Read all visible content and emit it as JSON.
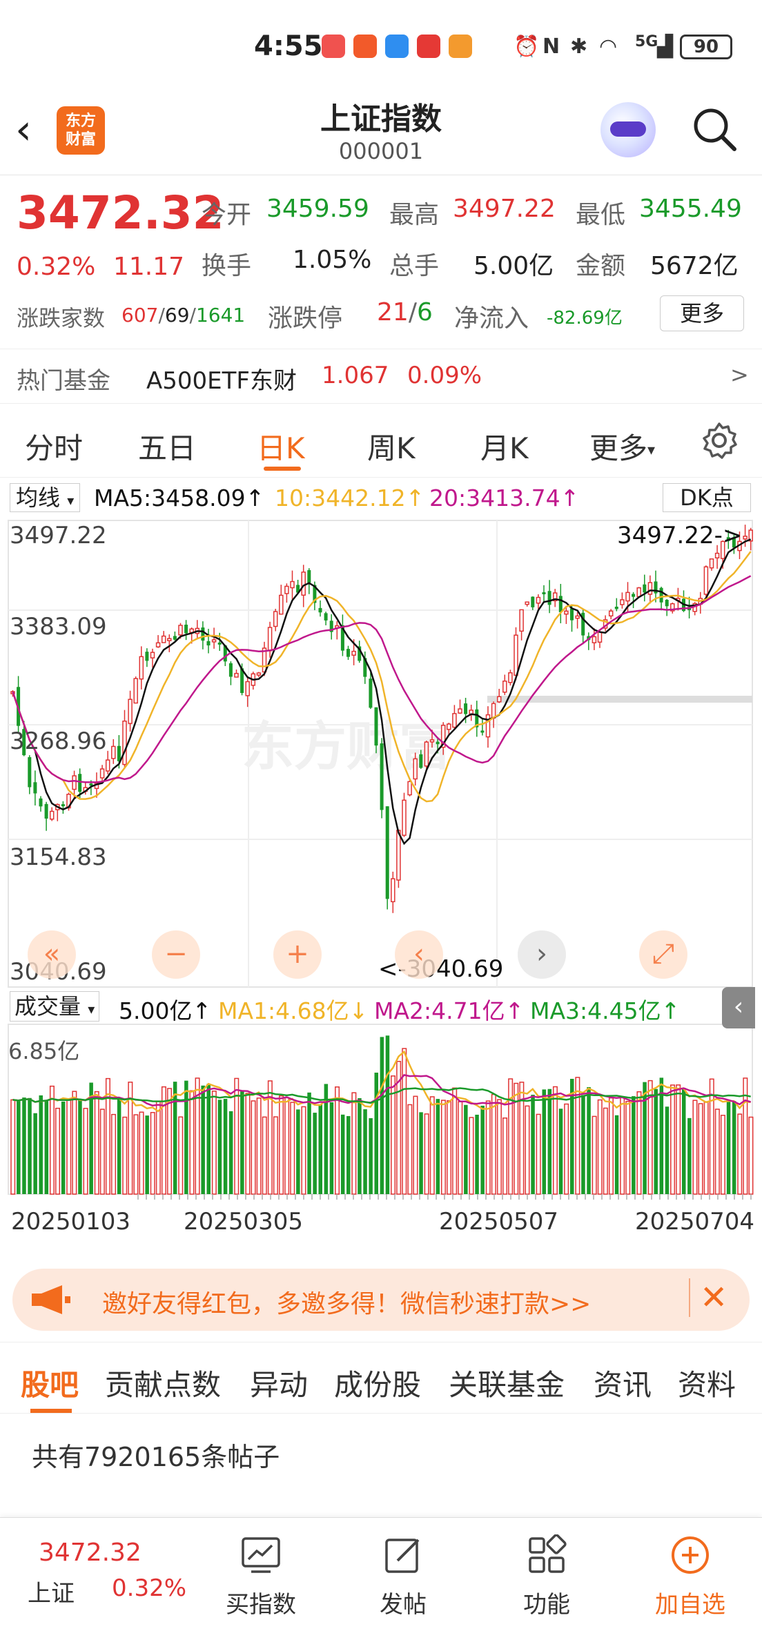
{
  "status": {
    "time": "4:55",
    "battery": "90",
    "network": "5G"
  },
  "header": {
    "title": "上证指数",
    "code": "000001",
    "logo_line1": "东方",
    "logo_line2": "财富"
  },
  "quote": {
    "price": "3472.32",
    "change_pct": "0.32%",
    "change_abs": "11.17",
    "open_label": "今开",
    "open": "3459.59",
    "high_label": "最高",
    "high": "3497.22",
    "low_label": "最低",
    "low": "3455.49",
    "turnover_label": "换手",
    "turnover": "1.05%",
    "volume_label": "总手",
    "volume": "5.00亿",
    "amount_label": "金额",
    "amount": "5672亿",
    "updown_label": "涨跌家数",
    "up_count": "607",
    "flat_count": "69",
    "down_count": "1641",
    "limit_label": "涨跌停",
    "limit_up": "21",
    "limit_down": "6",
    "netflow_label": "净流入",
    "netflow": "-82.69亿",
    "more_label": "更多"
  },
  "hotfund": {
    "label": "热门基金",
    "name": "A500ETF东财",
    "price": "1.067",
    "pct": "0.09%",
    "arrow": ">"
  },
  "period_tabs": [
    "分时",
    "五日",
    "日K",
    "周K",
    "月K",
    "更多"
  ],
  "active_period": "日K",
  "ma_bar": {
    "select": "均线",
    "ma5": "MA5:3458.09↑",
    "ma10": "10:3442.12↑",
    "ma20": "20:3413.74↑",
    "dk": "DK点",
    "colors": {
      "ma5": "#111111",
      "ma10": "#f0b429",
      "ma20": "#c0188c"
    }
  },
  "chart": {
    "y_labels": [
      "3497.22",
      "3383.09",
      "3268.96",
      "3154.83",
      "3040.69"
    ],
    "max_marker": "3497.22->",
    "min_marker": "<-3040.69",
    "watermark": "东方财富"
  },
  "vol_bar": {
    "select": "成交量",
    "vol": "5.00亿↑",
    "ma1": "MA1:4.68亿↓",
    "ma2": "MA2:4.71亿↑",
    "ma3": "MA3:4.45亿↑",
    "y_label": "6.85亿"
  },
  "dates": [
    "20250103",
    "20250305",
    "20250507",
    "20250704"
  ],
  "invite": {
    "text": "邀好友得红包，多邀多得！微信秒速打款>>"
  },
  "bottom_tabs": [
    "股吧",
    "贡献点数",
    "异动",
    "成份股",
    "关联基金",
    "资讯",
    "资料"
  ],
  "post_count": "共有7920165条帖子",
  "bottom_nav": {
    "index_price": "3472.32",
    "index_name": "上证",
    "index_pct": "0.32%",
    "items": [
      "买指数",
      "发帖",
      "功能",
      "加自选"
    ]
  }
}
